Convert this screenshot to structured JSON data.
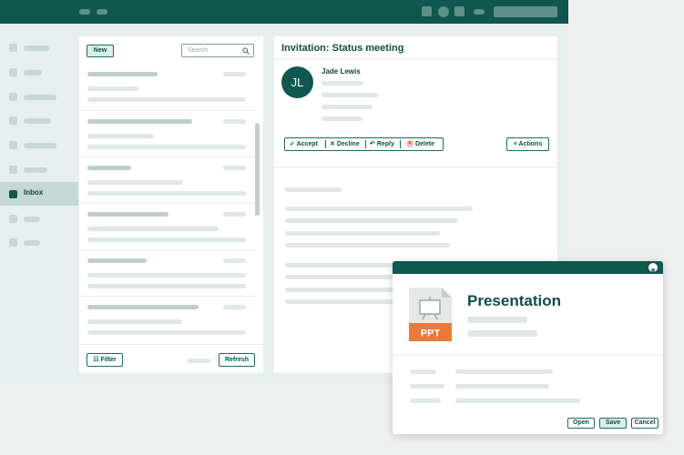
{
  "sidebar": {
    "inbox_label": "Inbox"
  },
  "list": {
    "new_label": "New",
    "search_placeholder": "Search",
    "filter_label": "Filter",
    "refresh_label": "Refresh"
  },
  "reading": {
    "subject": "Invitation: Status meeting",
    "avatar_initials": "JL",
    "sender_name": "Jade Lewis",
    "actions": {
      "accept": "Accept",
      "decline": "Decline",
      "reply": "Reply",
      "delete": "Delete",
      "more": "Actions"
    }
  },
  "attachment_popup": {
    "file_type": "PPT",
    "title": "Presentation",
    "open_label": "Open",
    "save_label": "Save",
    "cancel_label": "Cancel"
  },
  "colors": {
    "brand": "#0f574f",
    "ppt_accent": "#ea7a3a",
    "accent_light": "#daeeea"
  }
}
